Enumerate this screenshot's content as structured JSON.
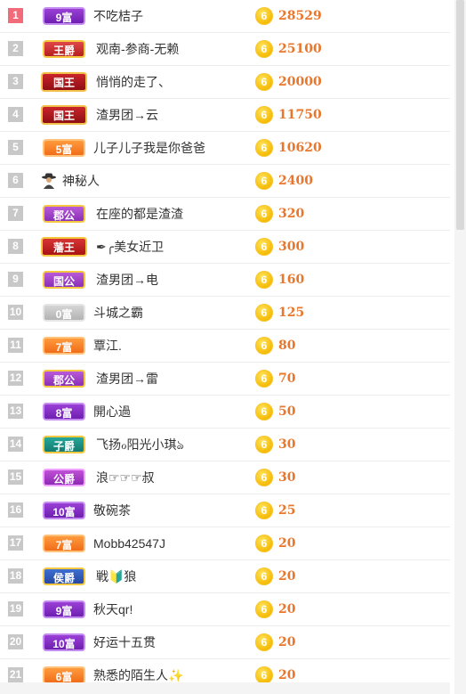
{
  "rows": [
    {
      "rank": "1",
      "badge_label": "9富",
      "badge_style": "b-fu-purple",
      "name": "不吃桔子",
      "score": "28529",
      "coin": "6"
    },
    {
      "rank": "2",
      "badge_label": "王爵",
      "badge_style": "b-wangjue",
      "name": "观南-参商-无赖",
      "score": "25100",
      "coin": "6"
    },
    {
      "rank": "3",
      "badge_label": "国王",
      "badge_style": "b-guowang",
      "name": "悄悄的走了、",
      "score": "20000",
      "coin": "6"
    },
    {
      "rank": "4",
      "badge_label": "国王",
      "badge_style": "b-guowang",
      "name": "渣男团→云",
      "score": "11750",
      "coin": "6"
    },
    {
      "rank": "5",
      "badge_label": "5富",
      "badge_style": "b-fu-orange",
      "name": "儿子儿子我是你爸爸",
      "score": "10620",
      "coin": "6"
    },
    {
      "rank": "6",
      "badge_label": "",
      "badge_style": "mystery",
      "name": "神秘人",
      "score": "2400",
      "coin": "6"
    },
    {
      "rank": "7",
      "badge_label": "郡公",
      "badge_style": "b-gong",
      "name": "在座的都是渣渣",
      "score": "320",
      "coin": "6"
    },
    {
      "rank": "8",
      "badge_label": "藩王",
      "badge_style": "b-fanwang",
      "name": "✒︎╭美女近卫",
      "score": "300",
      "coin": "6"
    },
    {
      "rank": "9",
      "badge_label": "国公",
      "badge_style": "b-gong",
      "name": "渣男团→电",
      "score": "160",
      "coin": "6"
    },
    {
      "rank": "10",
      "badge_label": "0富",
      "badge_style": "b-fu-gray",
      "name": "斗城之霸",
      "score": "125",
      "coin": "6"
    },
    {
      "rank": "11",
      "badge_label": "7富",
      "badge_style": "b-fu-orange",
      "name": "覃江.",
      "score": "80",
      "coin": "6"
    },
    {
      "rank": "12",
      "badge_label": "郡公",
      "badge_style": "b-gong",
      "name": "渣男团→雷",
      "score": "70",
      "coin": "6"
    },
    {
      "rank": "13",
      "badge_label": "8富",
      "badge_style": "b-fu-purple",
      "name": "開心過",
      "score": "50",
      "coin": "6"
    },
    {
      "rank": "14",
      "badge_label": "子爵",
      "badge_style": "b-ziju",
      "name": "飞扬ℴ阳光小琪ঌ",
      "score": "30",
      "coin": "6"
    },
    {
      "rank": "15",
      "badge_label": "公爵",
      "badge_style": "b-gongju",
      "name": "浪☞☞☞叔",
      "score": "30",
      "coin": "6"
    },
    {
      "rank": "16",
      "badge_label": "10富",
      "badge_style": "b-fu-purple",
      "name": "敬碗茶",
      "score": "25",
      "coin": "6"
    },
    {
      "rank": "17",
      "badge_label": "7富",
      "badge_style": "b-fu-orange",
      "name": "Mobb42547J",
      "score": "20",
      "coin": "6"
    },
    {
      "rank": "18",
      "badge_label": "侯爵",
      "badge_style": "b-houjue",
      "name": "戦🔰狼",
      "score": "20",
      "coin": "6"
    },
    {
      "rank": "19",
      "badge_label": "9富",
      "badge_style": "b-fu-purple",
      "name": "秋天qr!",
      "score": "20",
      "coin": "6"
    },
    {
      "rank": "20",
      "badge_label": "10富",
      "badge_style": "b-fu-purple",
      "name": "好运十五贯",
      "score": "20",
      "coin": "6"
    },
    {
      "rank": "21",
      "badge_label": "6富",
      "badge_style": "b-fu-orange",
      "name": "熟悉的陌生人✨",
      "score": "20",
      "coin": "6"
    }
  ],
  "colors": {
    "accent_score": "#e8772e",
    "rank_first": "#f26b7a",
    "rank_default": "#c8c8c8"
  }
}
